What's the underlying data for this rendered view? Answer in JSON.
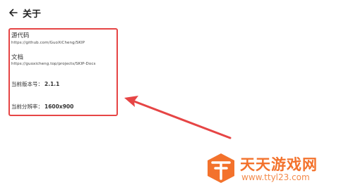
{
  "header": {
    "title": "关于"
  },
  "about": {
    "source_label": "源代码",
    "source_url": "https://github.com/GuoXiCheng/SKIP",
    "docs_label": "文档",
    "docs_url": "https://guoxicheng.top/projects/SKIP-Docs",
    "version_label": "当前版本号：",
    "version_value": "2.1.1",
    "resolution_label": "当前分辨率：",
    "resolution_value": "1600x900"
  },
  "annotation": {
    "color": "#e64545"
  },
  "watermark": {
    "text": "天天游戏网",
    "url": "www.ttyl23.com",
    "color": "#f3722c"
  }
}
